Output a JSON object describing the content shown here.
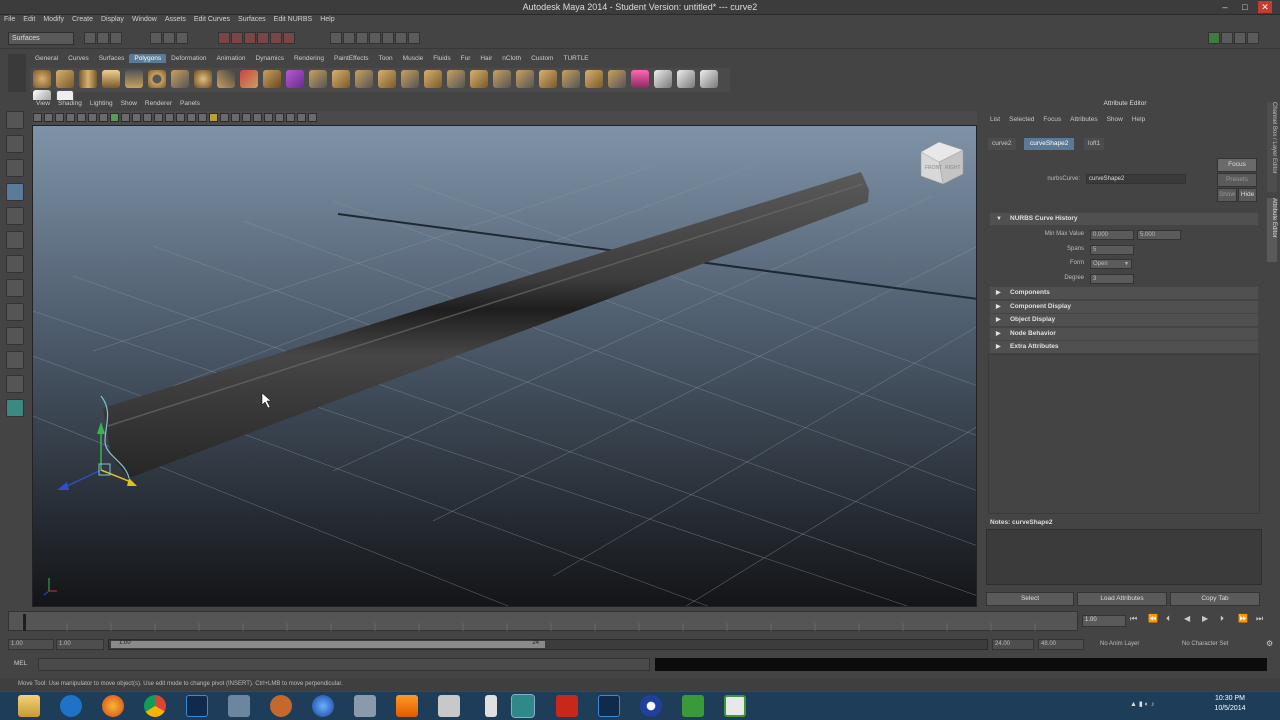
{
  "window": {
    "title": "Autodesk Maya 2014 - Student Version: untitled*  ---  curve2",
    "minimize": "‒",
    "maximize": "□",
    "close": "✕"
  },
  "menubar": [
    "File",
    "Edit",
    "Modify",
    "Create",
    "Display",
    "Window",
    "Assets",
    "Edit Curves",
    "Surfaces",
    "Edit NURBS",
    "Help"
  ],
  "statusline": {
    "mode_dropdown": "Surfaces"
  },
  "shelf": {
    "tabs": [
      "General",
      "Curves",
      "Surfaces",
      "Polygons",
      "Deformation",
      "Animation",
      "Dynamics",
      "Rendering",
      "PaintEffects",
      "Toon",
      "Muscle",
      "Fluids",
      "Fur",
      "Hair",
      "nCloth",
      "Custom",
      "TURTLE"
    ],
    "active_tab": "Polygons"
  },
  "panel": {
    "menus": [
      "View",
      "Shading",
      "Lighting",
      "Show",
      "Renderer",
      "Panels"
    ]
  },
  "viewcube": {
    "front": "FRONT",
    "right": "RIGHT"
  },
  "attribute_editor": {
    "title": "Attribute Editor",
    "menus": [
      "List",
      "Selected",
      "Focus",
      "Attributes",
      "Show",
      "Help"
    ],
    "tabs": [
      "curve2",
      "curveShape2",
      "loft1"
    ],
    "active_tab": "curveShape2",
    "node_label": "nurbsCurve:",
    "node_value": "curveShape2",
    "focus_button": "Focus",
    "presets_button": "Presets",
    "show_button": "Show",
    "hide_button": "Hide",
    "section_open": "NURBS Curve History",
    "minmax_label": "Min Max Value",
    "min_value": "0.000",
    "max_value": "5.000",
    "spans_label": "Spans",
    "spans_value": "5",
    "form_label": "Form",
    "form_value": "Open",
    "degree_label": "Degree",
    "degree_value": "3",
    "sections": [
      "Components",
      "Component Display",
      "Object Display",
      "Node Behavior",
      "Extra Attributes"
    ],
    "notes_label": "Notes: curveShape2",
    "select_button": "Select",
    "load_button": "Load Attributes",
    "copy_button": "Copy Tab",
    "side_tabs": [
      "Channel Box / Layer Editor",
      "Attribute Editor"
    ]
  },
  "time": {
    "current": "1.00",
    "range_start": "1.00",
    "start_inner": "1.00",
    "range_end_inner": "24",
    "end": "24.00",
    "end_total": "48.00",
    "anim_layer": "No Anim Layer",
    "char_set": "No Character Set"
  },
  "cmdline": {
    "label": "MEL"
  },
  "helpline": {
    "text": "Move Tool: Use manipulator to move object(s). Use edit mode to change pivot (INSERT). Ctrl+LMB to move perpendicular."
  },
  "clock": {
    "time": "10:30 PM",
    "date": "10/5/2014"
  },
  "colors": {
    "accent": "#5b7a96",
    "viewport_top": "#7f93a8",
    "viewport_bottom": "#131417",
    "taskbar": "#1d3d58"
  }
}
